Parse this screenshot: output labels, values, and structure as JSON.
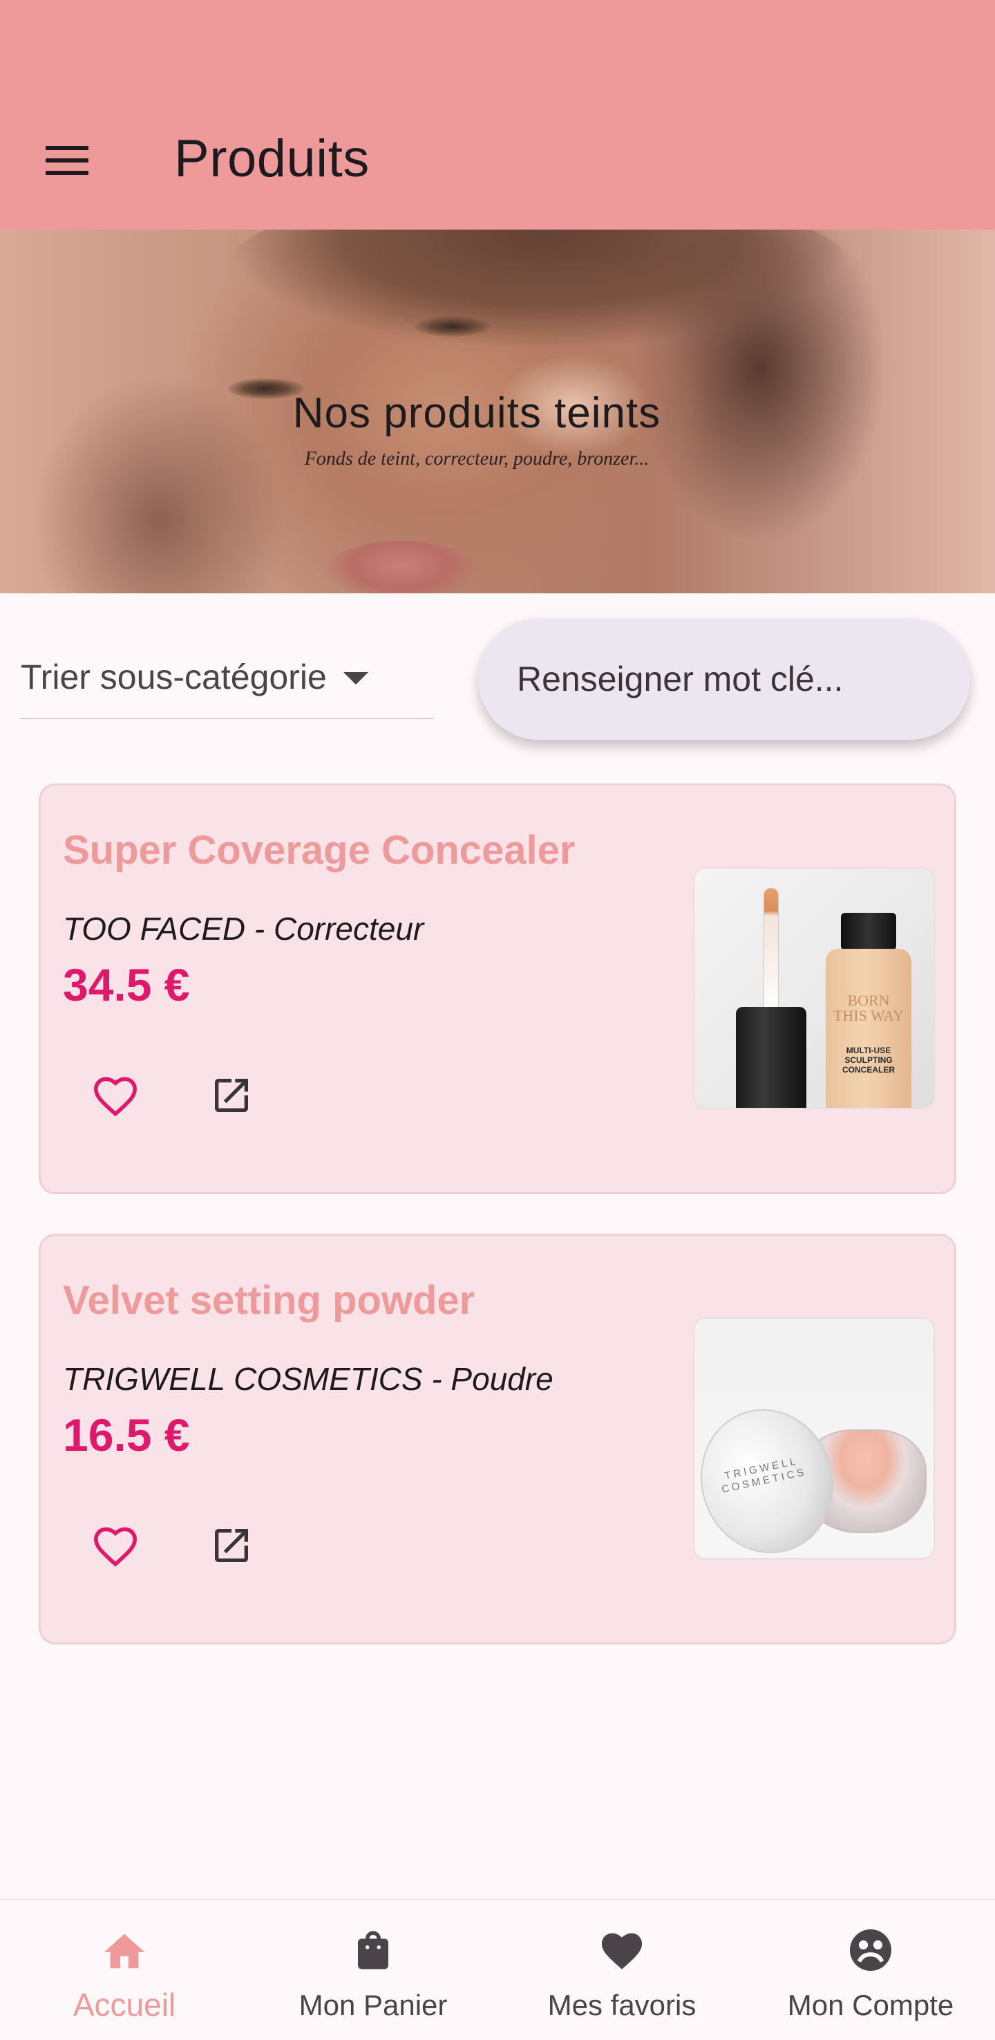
{
  "appbar": {
    "title": "Produits",
    "menu_icon": "menu-icon"
  },
  "banner": {
    "title": "Nos produits teints",
    "subtitle": "Fonds de teint, correcteur, poudre, bronzer..."
  },
  "filters": {
    "sort_label": "Trier sous-catégorie",
    "search_placeholder": "Renseigner mot clé..."
  },
  "products": [
    {
      "name": "Super Coverage Concealer",
      "brand_category": "TOO FACED - Correcteur",
      "price": "34.5 €",
      "image_label_top": "BORN THIS WAY",
      "image_label_bottom": "MULTI-USE SCULPTING CONCEALER"
    },
    {
      "name": "Velvet setting powder",
      "brand_category": "TRIGWELL COSMETICS - Poudre",
      "price": "16.5 €",
      "image_label_top": "TRIGWELL COSMETICS"
    }
  ],
  "bottom_nav": [
    {
      "label": "Accueil",
      "icon": "home-icon",
      "active": true
    },
    {
      "label": "Mon Panier",
      "icon": "shopping-bag-icon",
      "active": false
    },
    {
      "label": "Mes favoris",
      "icon": "heart-icon",
      "active": false
    },
    {
      "label": "Mon Compte",
      "icon": "account-circle-icon",
      "active": false
    }
  ],
  "colors": {
    "appbar": "#ee9a9b",
    "accent": "#ee9a9b",
    "price": "#e0186b",
    "card_bg": "#f9e2e8",
    "search_bg": "#ece6f1"
  }
}
